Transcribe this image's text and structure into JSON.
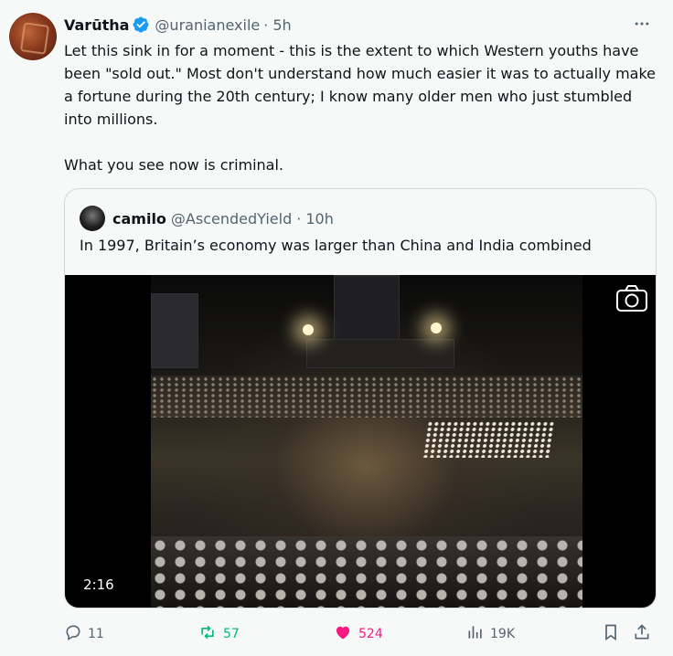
{
  "tweet": {
    "author_name": "Varūtha",
    "author_handle": "@uranianexile",
    "separator": "·",
    "time": "5h",
    "text": "Let this sink in for a moment - this is the extent to which Western youths have been \"sold out.\" Most don't understand how much easier it was to actually make a fortune during the 20th century; I know many older men who just stumbled into millions.\n\nWhat you see now is criminal.",
    "more_icon": "more-horizontal-icon"
  },
  "quote": {
    "author_name": "camilo",
    "author_handle": "@AscendedYield",
    "separator": "·",
    "time": "10h",
    "text": "In 1997, Britain’s economy was larger than China and India combined",
    "video_duration": "2:16"
  },
  "actions": {
    "replies": "11",
    "reposts": "57",
    "likes": "524",
    "views": "19K"
  },
  "colors": {
    "verified": "#1d9bf0",
    "repost": "#00ba7c",
    "like": "#f91880",
    "muted": "#536471"
  }
}
